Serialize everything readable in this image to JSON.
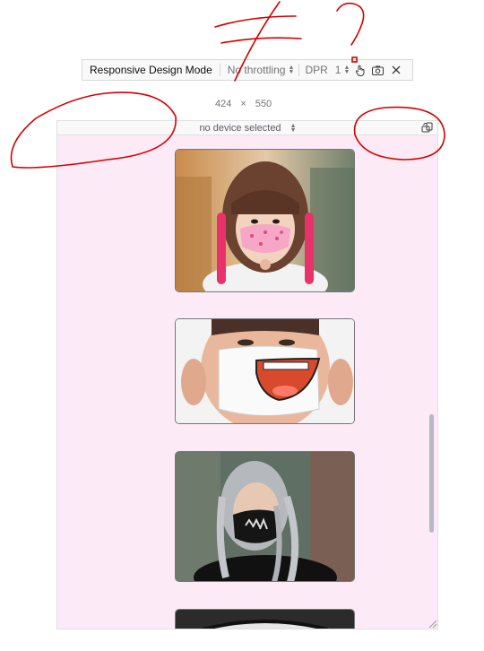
{
  "toolbar": {
    "title": "Responsive Design Mode",
    "throttling": "No throttling",
    "dpr_label": "DPR",
    "dpr_value": "1"
  },
  "size": {
    "width": "424",
    "times": "×",
    "height": "550"
  },
  "device": {
    "selected": "no device selected"
  },
  "colors": {
    "viewport_bg": "#fcebf6",
    "annotation_red": "#d40000"
  },
  "icons": [
    "touch-icon",
    "screenshot-icon",
    "close-icon",
    "rotate-icon"
  ],
  "images": [
    {
      "name": "mask-photo-pink-hair"
    },
    {
      "name": "mask-photo-cartoon-mouth"
    },
    {
      "name": "mask-photo-adidas-braids"
    },
    {
      "name": "mask-photo-partial"
    }
  ]
}
